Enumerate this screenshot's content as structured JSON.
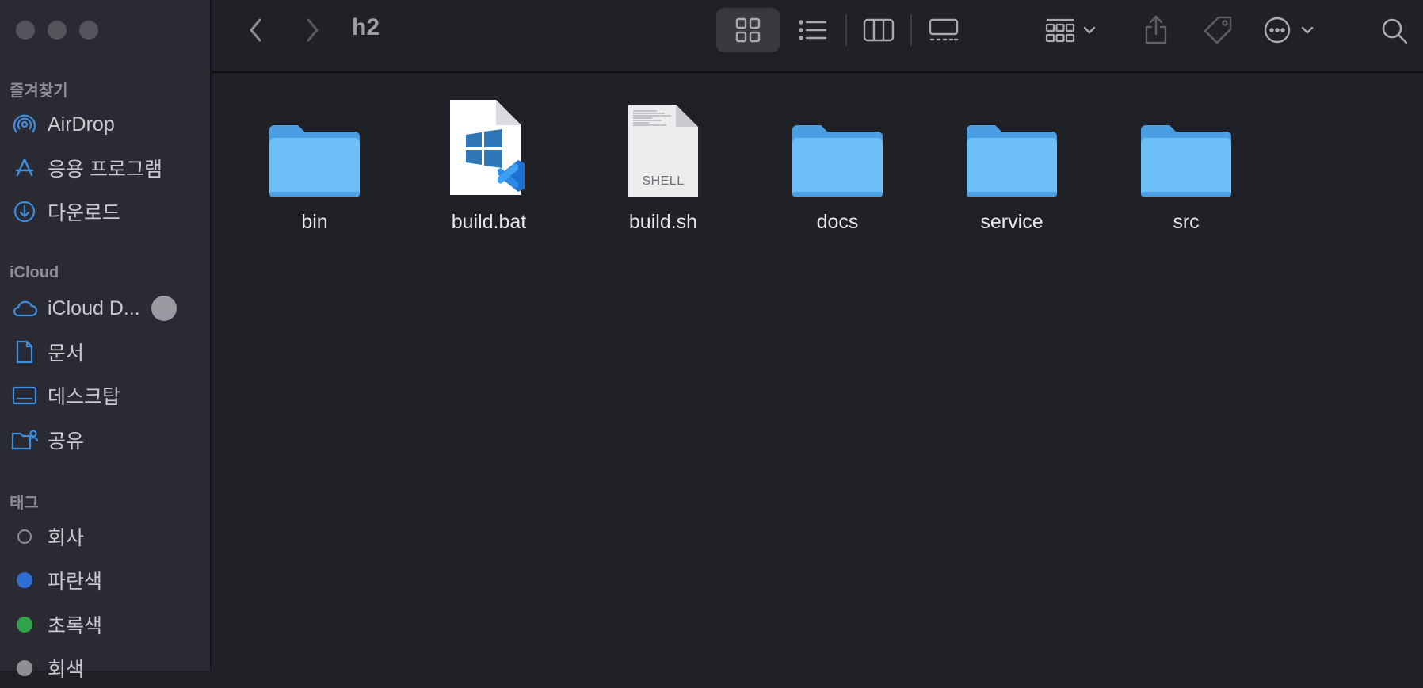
{
  "window": {
    "path_title": "h2"
  },
  "sidebar": {
    "favorites_title": "즐겨찾기",
    "favorites": [
      {
        "label": "AirDrop",
        "icon": "airdrop-icon"
      },
      {
        "label": "응용 프로그램",
        "icon": "applications-icon"
      },
      {
        "label": "다운로드",
        "icon": "downloads-icon"
      }
    ],
    "icloud_title": "iCloud",
    "icloud": [
      {
        "label": "iCloud D...",
        "icon": "icloud-icon"
      },
      {
        "label": "문서",
        "icon": "document-icon"
      },
      {
        "label": "데스크탑",
        "icon": "desktop-icon"
      },
      {
        "label": "공유",
        "icon": "shared-folder-icon"
      }
    ],
    "tags_title": "태그",
    "tags": [
      {
        "label": "회사",
        "color": "transparent"
      },
      {
        "label": "파란색",
        "color": "#3a7ee6"
      },
      {
        "label": "초록색",
        "color": "#35b04a"
      },
      {
        "label": "회색",
        "color": "#8e8e93"
      }
    ]
  },
  "toolbar": {
    "icons": [
      "back-icon",
      "forward-icon",
      "icon-view-icon",
      "list-view-icon",
      "column-view-icon",
      "gallery-view-icon",
      "group-icon",
      "share-icon",
      "tag-icon",
      "more-actions-icon",
      "search-icon"
    ]
  },
  "files": [
    {
      "name": "bin",
      "kind": "folder"
    },
    {
      "name": "build.bat",
      "kind": "bat"
    },
    {
      "name": "build.sh",
      "kind": "shell",
      "badge": "SHELL"
    },
    {
      "name": "docs",
      "kind": "folder"
    },
    {
      "name": "service",
      "kind": "folder"
    },
    {
      "name": "src",
      "kind": "folder"
    }
  ],
  "colors": {
    "accent": "#3a82d8",
    "folder": "#5fb6f5",
    "sidebar_icon": "#3d8de0"
  }
}
